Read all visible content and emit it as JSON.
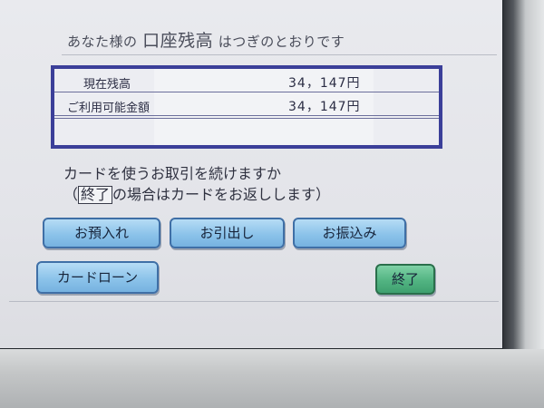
{
  "header": {
    "title_prefix": "あなた様の",
    "title_main": "口座残高",
    "title_suffix": "はつぎのとおりです"
  },
  "balance": {
    "rows": [
      {
        "label": "現在残高",
        "value": "34，147円"
      },
      {
        "label": "ご利用可能金額",
        "value": "34，147円"
      }
    ]
  },
  "prompt": {
    "question": "カードを使うお取引を続けますか",
    "note_open": "（",
    "note_key": "終了",
    "note_rest": "の場合はカードをお返しします）"
  },
  "buttons": {
    "deposit": "お預入れ",
    "withdraw": "お引出し",
    "transfer": "お振込み",
    "card_loan": "カードローン",
    "end": "終了"
  },
  "colors": {
    "button_blue": "#8cc3ea",
    "button_green": "#52b482",
    "box_border": "#3b3f99"
  }
}
